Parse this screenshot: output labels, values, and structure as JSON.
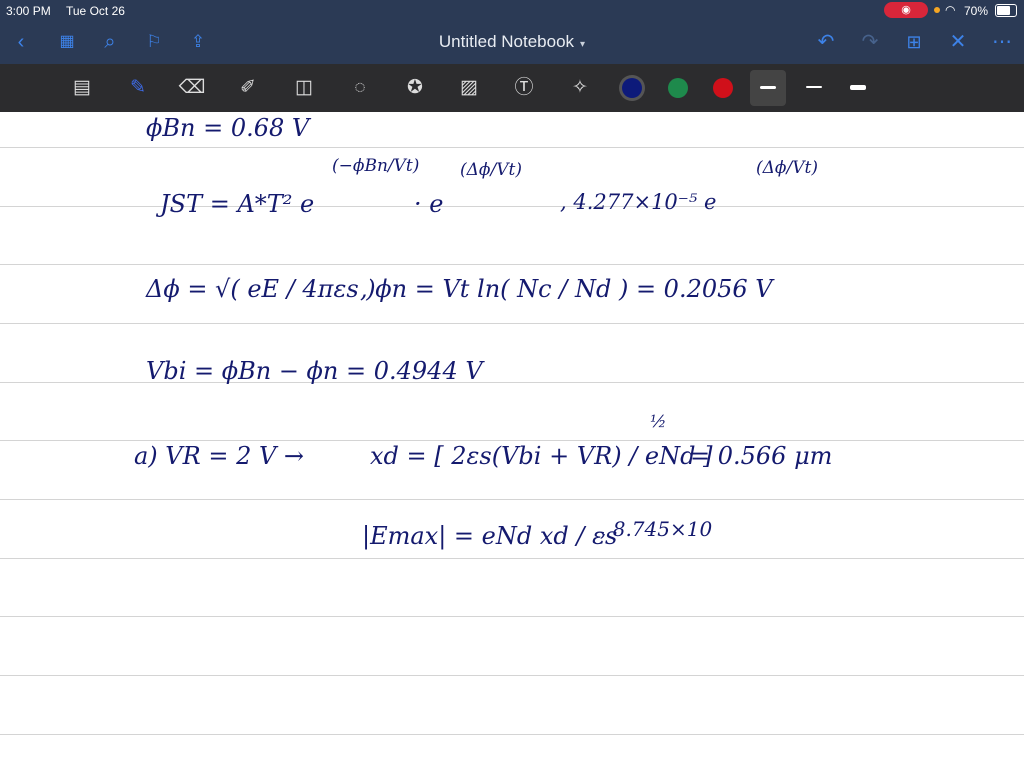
{
  "status": {
    "time": "3:00 PM",
    "date": "Tue Oct 26",
    "battery": "70%",
    "record_icon": "record-icon"
  },
  "nav": {
    "title": "Untitled Notebook",
    "icons": [
      "back",
      "thumbnails",
      "search",
      "bookmark",
      "share",
      "undo",
      "redo",
      "add-page",
      "close",
      "more"
    ]
  },
  "toolbar": {
    "tools": [
      "page-view",
      "pen",
      "eraser",
      "highlighter",
      "shapes",
      "lasso",
      "elements",
      "image",
      "text",
      "laser"
    ],
    "colors": [
      "#0d1a7a",
      "#1e8a4c",
      "#d0101a"
    ],
    "active_color": "#0d1a7a"
  },
  "notes": {
    "l1": "ϕBn = 0.68 V",
    "l2a": "JST = A*T² e",
    "l2b": "(−ϕBn/Vt)",
    "l2c": "· e",
    "l2d": "(Δϕ/Vt)",
    "l2e": ", 4.277×10⁻⁵ e",
    "l2f": "(Δϕ/Vt)",
    "l3a": "Δϕ = √( eE / 4πεs )",
    "l3b": ",  ϕn = Vt ln( Nc / Nd ) = 0.2056 V",
    "l4": "Vbi = ϕBn − ϕn = 0.4944 V",
    "l5a": "a)  VR = 2 V  →",
    "l5b": "xd = [ 2εs(Vbi + VR) / eNd ]",
    "l5c": "½",
    "l5d": "= 0.566 μm",
    "l6a": "|Emax| = eNd xd / εs",
    "l6b": ", 8.745×10"
  }
}
